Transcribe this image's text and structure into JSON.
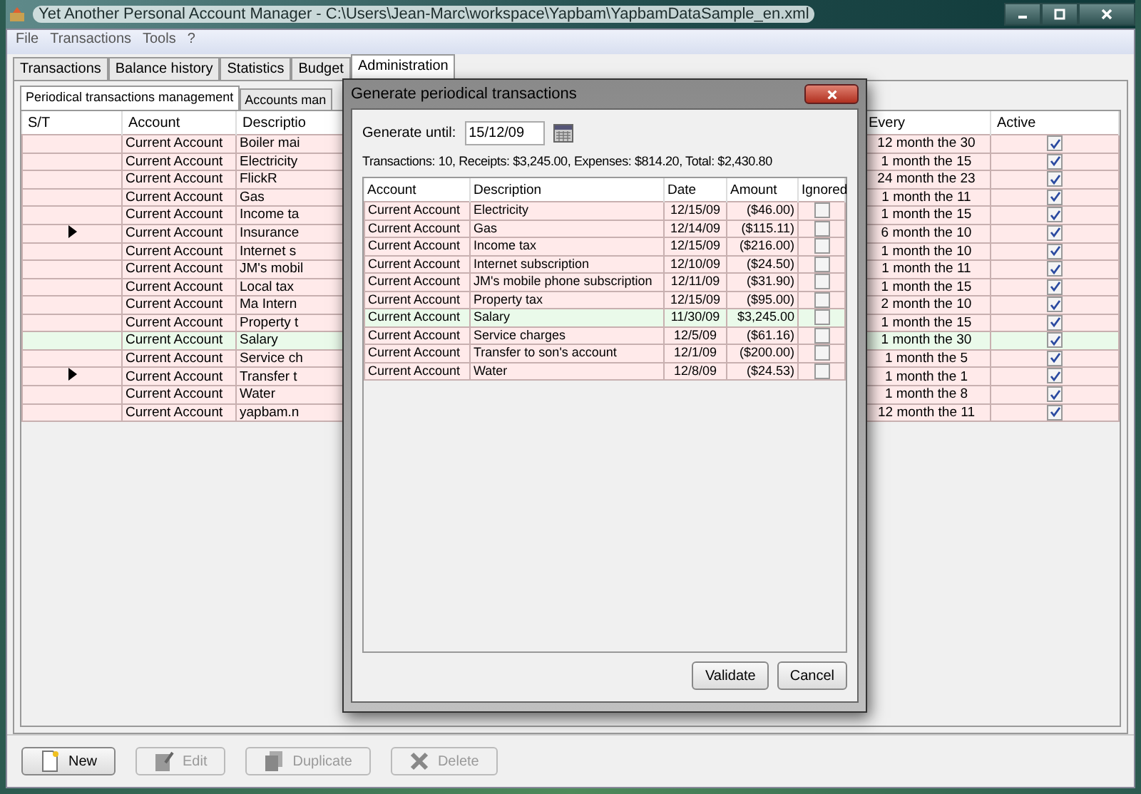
{
  "window": {
    "title": "Yet Another Personal Account Manager - C:\\Users\\Jean-Marc\\workspace\\Yapbam\\YapbamDataSample_en.xml"
  },
  "menu": [
    "File",
    "Transactions",
    "Tools",
    "?"
  ],
  "tabs": [
    {
      "label": "Transactions",
      "selected": false
    },
    {
      "label": "Balance history",
      "selected": false
    },
    {
      "label": "Statistics",
      "selected": false
    },
    {
      "label": "Budget",
      "selected": false
    },
    {
      "label": "Administration",
      "selected": true
    }
  ],
  "subtabs": [
    {
      "label": "Periodical transactions management",
      "selected": true
    },
    {
      "label": "Accounts man",
      "selected": false
    }
  ],
  "table": {
    "columns": [
      "S/T",
      "Account",
      "Descriptio",
      "Every",
      "Active"
    ],
    "rows": [
      {
        "kind": "expense",
        "marker": false,
        "account": "Current Account",
        "description": "Boiler mai",
        "every": "12 month the 30",
        "active": true
      },
      {
        "kind": "expense",
        "marker": false,
        "account": "Current Account",
        "description": "Electricity",
        "every": "1 month the 15",
        "active": true
      },
      {
        "kind": "expense",
        "marker": false,
        "account": "Current Account",
        "description": "FlickR",
        "every": "24 month the 23",
        "active": true
      },
      {
        "kind": "expense",
        "marker": false,
        "account": "Current Account",
        "description": "Gas",
        "every": "1 month the 11",
        "active": true
      },
      {
        "kind": "expense",
        "marker": false,
        "account": "Current Account",
        "description": "Income ta",
        "every": "1 month the 15",
        "active": true
      },
      {
        "kind": "expense",
        "marker": true,
        "account": "Current Account",
        "description": "Insurance",
        "every": "6 month the 10",
        "active": true
      },
      {
        "kind": "expense",
        "marker": false,
        "account": "Current Account",
        "description": "Internet s",
        "every": "1 month the 10",
        "active": true
      },
      {
        "kind": "expense",
        "marker": false,
        "account": "Current Account",
        "description": "JM's mobil",
        "every": "1 month the 11",
        "active": true
      },
      {
        "kind": "expense",
        "marker": false,
        "account": "Current Account",
        "description": "Local tax",
        "every": "1 month the 15",
        "active": true
      },
      {
        "kind": "expense",
        "marker": false,
        "account": "Current Account",
        "description": "Ma Intern",
        "every": "2 month the 10",
        "active": true
      },
      {
        "kind": "expense",
        "marker": false,
        "account": "Current Account",
        "description": "Property t",
        "every": "1 month the 15",
        "active": true
      },
      {
        "kind": "receipt",
        "marker": false,
        "account": "Current Account",
        "description": "Salary",
        "every": "1 month the 30",
        "active": true
      },
      {
        "kind": "expense",
        "marker": false,
        "account": "Current Account",
        "description": "Service ch",
        "every": "1 month the 5",
        "active": true
      },
      {
        "kind": "expense",
        "marker": true,
        "account": "Current Account",
        "description": "Transfer t",
        "every": "1 month the 1",
        "active": true
      },
      {
        "kind": "expense",
        "marker": false,
        "account": "Current Account",
        "description": "Water",
        "every": "1 month the 8",
        "active": true
      },
      {
        "kind": "expense",
        "marker": false,
        "account": "Current Account",
        "description": "yapbam.n",
        "every": "12 month the 11",
        "active": true
      }
    ]
  },
  "buttons": [
    {
      "label": "New",
      "disabled": false
    },
    {
      "label": "Edit",
      "disabled": true
    },
    {
      "label": "Duplicate",
      "disabled": true
    },
    {
      "label": "Delete",
      "disabled": true
    }
  ],
  "dialog": {
    "title": "Generate periodical transactions",
    "until_label": "Generate until:",
    "until_value": "15/12/09",
    "summary": "Transactions: 10, Receipts: $3,245.00, Expenses: $814.20, Total: $2,430.80",
    "columns": [
      "Account",
      "Description",
      "Date",
      "Amount",
      "Ignored"
    ],
    "rows": [
      {
        "kind": "expense",
        "account": "Current Account",
        "description": "Electricity",
        "date": "12/15/09",
        "amount": "($46.00)",
        "ignored": false
      },
      {
        "kind": "expense",
        "account": "Current Account",
        "description": "Gas",
        "date": "12/14/09",
        "amount": "($115.11)",
        "ignored": false
      },
      {
        "kind": "expense",
        "account": "Current Account",
        "description": "Income tax",
        "date": "12/15/09",
        "amount": "($216.00)",
        "ignored": false
      },
      {
        "kind": "expense",
        "account": "Current Account",
        "description": "Internet subscription",
        "date": "12/10/09",
        "amount": "($24.50)",
        "ignored": false
      },
      {
        "kind": "expense",
        "account": "Current Account",
        "description": "JM's mobile phone subscription",
        "date": "12/11/09",
        "amount": "($31.90)",
        "ignored": false
      },
      {
        "kind": "expense",
        "account": "Current Account",
        "description": "Property tax",
        "date": "12/15/09",
        "amount": "($95.00)",
        "ignored": false
      },
      {
        "kind": "receipt",
        "account": "Current Account",
        "description": "Salary",
        "date": "11/30/09",
        "amount": "$3,245.00",
        "ignored": false
      },
      {
        "kind": "expense",
        "account": "Current Account",
        "description": "Service charges",
        "date": "12/5/09",
        "amount": "($61.16)",
        "ignored": false
      },
      {
        "kind": "expense",
        "account": "Current Account",
        "description": "Transfer to son's account",
        "date": "12/1/09",
        "amount": "($200.00)",
        "ignored": false
      },
      {
        "kind": "expense",
        "account": "Current Account",
        "description": "Water",
        "date": "12/8/09",
        "amount": "($24.53)",
        "ignored": false
      }
    ],
    "buttons": [
      "Validate",
      "Cancel"
    ]
  }
}
